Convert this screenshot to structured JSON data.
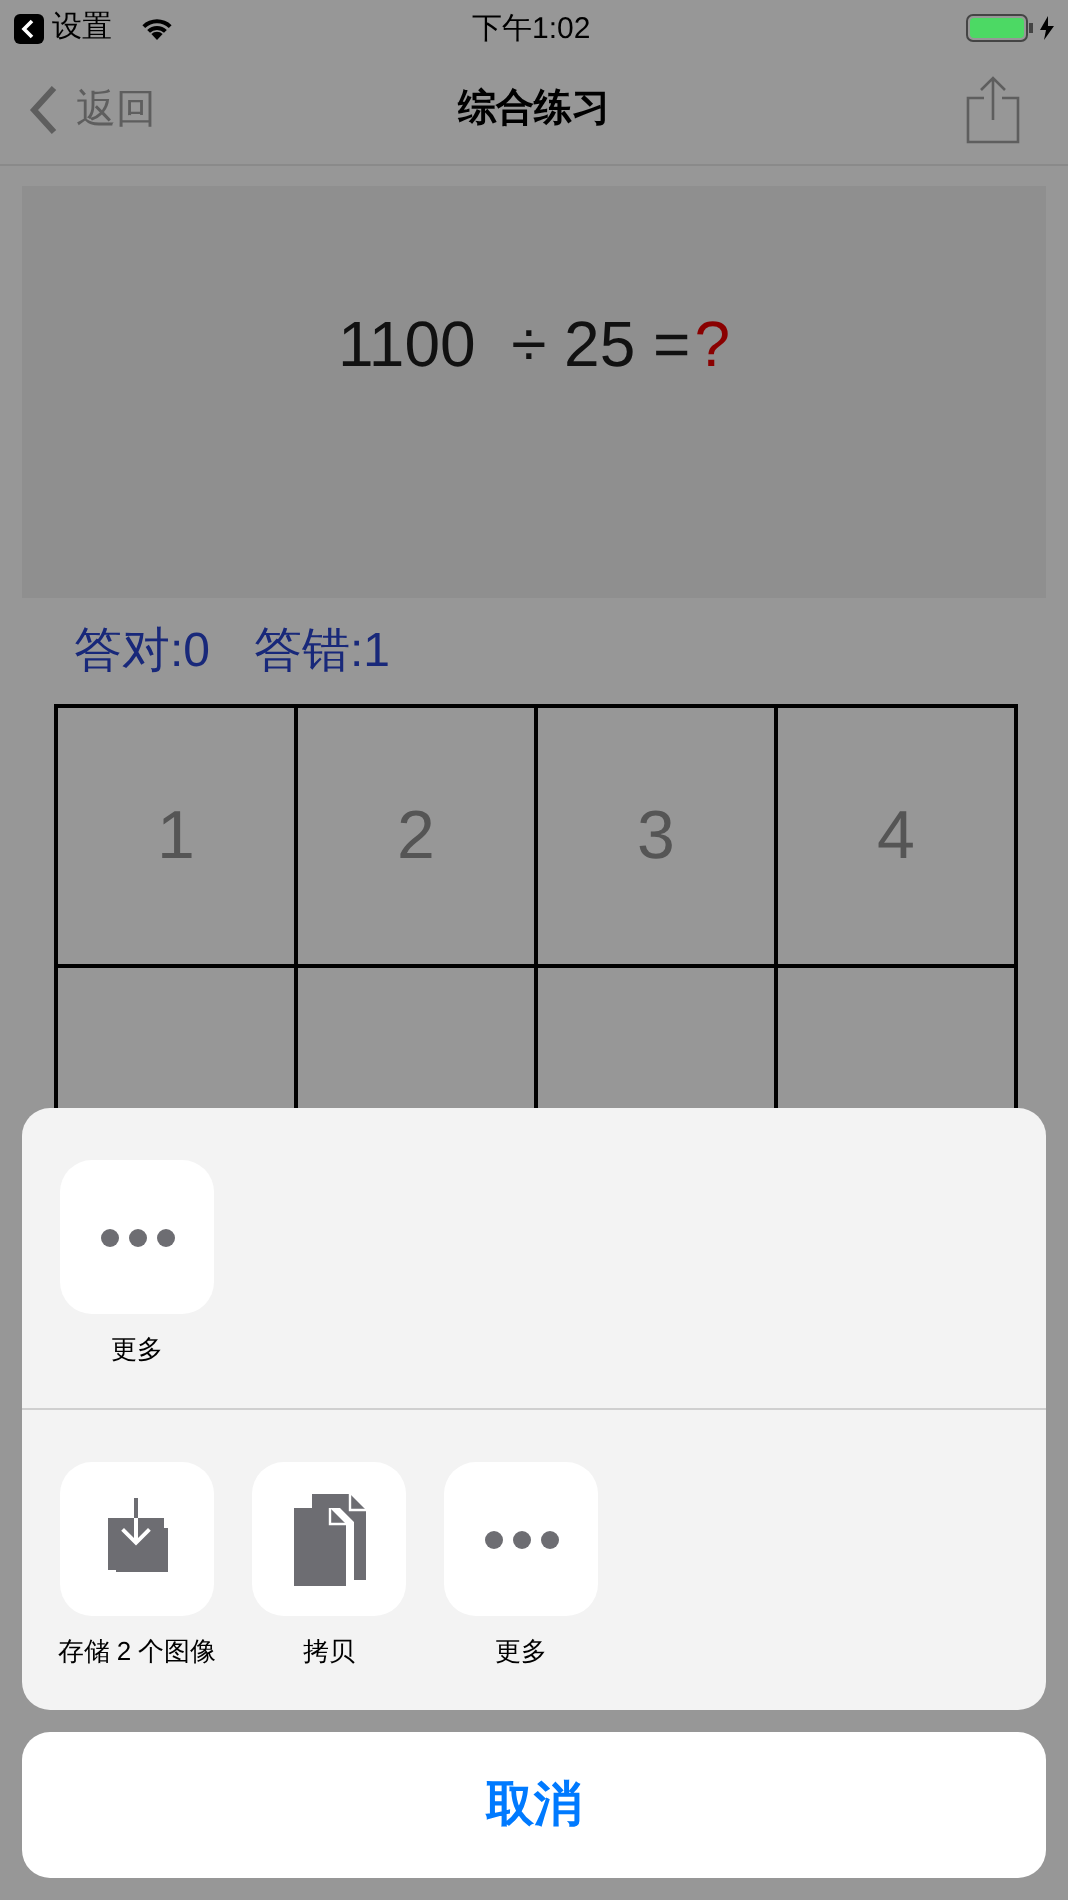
{
  "status_bar": {
    "back_app": "设置",
    "time": "下午1:02",
    "charging": true
  },
  "nav": {
    "back": "返回",
    "title": "综合练习"
  },
  "question": {
    "expression": "1100  ÷ 25 =",
    "answer": "?"
  },
  "score": [
    "答对:0",
    "答错:1"
  ],
  "keypad": [
    "1",
    "2",
    "3",
    "4"
  ],
  "share_sheet": {
    "rows": [
      [
        {
          "label": "更多",
          "kind": "more"
        }
      ],
      [
        {
          "label": "存储 2 个图像",
          "kind": "save"
        },
        {
          "label": "拷贝",
          "kind": "copy"
        },
        {
          "label": "更多",
          "kind": "more"
        }
      ]
    ],
    "cancel": "取消"
  }
}
